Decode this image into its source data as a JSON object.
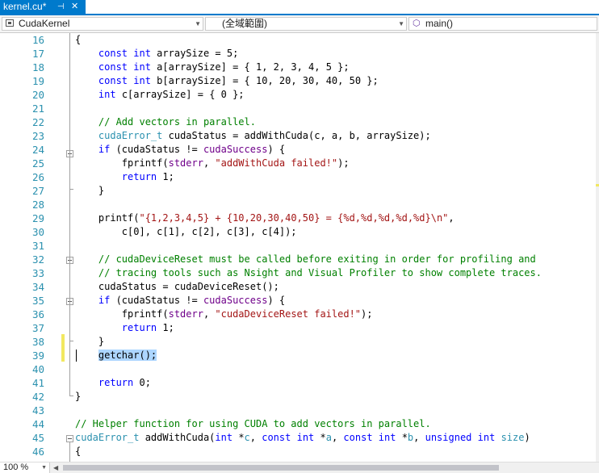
{
  "tab": {
    "title": "kernel.cu*",
    "pin_icon": "pin-icon",
    "close_icon": "close-icon"
  },
  "navbar": {
    "project": "CudaKernel",
    "scope": "(全域範圍)",
    "member": "main()"
  },
  "editor": {
    "lines": [
      {
        "n": "16",
        "s": [
          {
            "t": "{"
          }
        ]
      },
      {
        "n": "17",
        "s": [
          {
            "t": "    "
          },
          {
            "t": "const",
            "c": "kw"
          },
          {
            "t": " "
          },
          {
            "t": "int",
            "c": "kw"
          },
          {
            "t": " arraySize = 5;"
          }
        ]
      },
      {
        "n": "18",
        "s": [
          {
            "t": "    "
          },
          {
            "t": "const",
            "c": "kw"
          },
          {
            "t": " "
          },
          {
            "t": "int",
            "c": "kw"
          },
          {
            "t": " a[arraySize] = { 1, 2, 3, 4, 5 };"
          }
        ]
      },
      {
        "n": "19",
        "s": [
          {
            "t": "    "
          },
          {
            "t": "const",
            "c": "kw"
          },
          {
            "t": " "
          },
          {
            "t": "int",
            "c": "kw"
          },
          {
            "t": " b[arraySize] = { 10, 20, 30, 40, 50 };"
          }
        ]
      },
      {
        "n": "20",
        "s": [
          {
            "t": "    "
          },
          {
            "t": "int",
            "c": "kw"
          },
          {
            "t": " c[arraySize] = { 0 };"
          }
        ]
      },
      {
        "n": "21",
        "s": []
      },
      {
        "n": "22",
        "s": [
          {
            "t": "    "
          },
          {
            "t": "// Add vectors in parallel.",
            "c": "cm"
          }
        ]
      },
      {
        "n": "23",
        "s": [
          {
            "t": "    "
          },
          {
            "t": "cudaError_t",
            "c": "ty"
          },
          {
            "t": " cudaStatus = addWithCuda(c, a, b, arraySize);"
          }
        ]
      },
      {
        "n": "24",
        "s": [
          {
            "t": "    "
          },
          {
            "t": "if",
            "c": "kw"
          },
          {
            "t": " (cudaStatus != "
          },
          {
            "t": "cudaSuccess",
            "c": "mac"
          },
          {
            "t": ") {"
          }
        ]
      },
      {
        "n": "25",
        "s": [
          {
            "t": "        fprintf("
          },
          {
            "t": "stderr",
            "c": "mac"
          },
          {
            "t": ", "
          },
          {
            "t": "\"addWithCuda failed!\"",
            "c": "str"
          },
          {
            "t": ");"
          }
        ]
      },
      {
        "n": "26",
        "s": [
          {
            "t": "        "
          },
          {
            "t": "return",
            "c": "kw"
          },
          {
            "t": " 1;"
          }
        ]
      },
      {
        "n": "27",
        "s": [
          {
            "t": "    }"
          }
        ]
      },
      {
        "n": "28",
        "s": []
      },
      {
        "n": "29",
        "s": [
          {
            "t": "    printf("
          },
          {
            "t": "\"{1,2,3,4,5} + {10,20,30,40,50} = {%d,%d,%d,%d,%d}\\n\"",
            "c": "str"
          },
          {
            "t": ","
          }
        ]
      },
      {
        "n": "30",
        "s": [
          {
            "t": "        c[0], c[1], c[2], c[3], c[4]);"
          }
        ]
      },
      {
        "n": "31",
        "s": []
      },
      {
        "n": "32",
        "s": [
          {
            "t": "    "
          },
          {
            "t": "// cudaDeviceReset must be called before exiting in order for profiling and",
            "c": "cm"
          }
        ]
      },
      {
        "n": "33",
        "s": [
          {
            "t": "    "
          },
          {
            "t": "// tracing tools such as Nsight and Visual Profiler to show complete traces.",
            "c": "cm"
          }
        ]
      },
      {
        "n": "34",
        "s": [
          {
            "t": "    cudaStatus = cudaDeviceReset();"
          }
        ]
      },
      {
        "n": "35",
        "s": [
          {
            "t": "    "
          },
          {
            "t": "if",
            "c": "kw"
          },
          {
            "t": " (cudaStatus != "
          },
          {
            "t": "cudaSuccess",
            "c": "mac"
          },
          {
            "t": ") {"
          }
        ]
      },
      {
        "n": "36",
        "s": [
          {
            "t": "        fprintf("
          },
          {
            "t": "stderr",
            "c": "mac"
          },
          {
            "t": ", "
          },
          {
            "t": "\"cudaDeviceReset failed!\"",
            "c": "str"
          },
          {
            "t": ");"
          }
        ]
      },
      {
        "n": "37",
        "s": [
          {
            "t": "        "
          },
          {
            "t": "return",
            "c": "kw"
          },
          {
            "t": " 1;"
          }
        ]
      },
      {
        "n": "38",
        "s": [
          {
            "t": "    }"
          }
        ]
      },
      {
        "n": "39",
        "s": [
          {
            "t": "    getchar();",
            "c": "sel"
          }
        ]
      },
      {
        "n": "40",
        "s": []
      },
      {
        "n": "41",
        "s": [
          {
            "t": "    "
          },
          {
            "t": "return",
            "c": "kw"
          },
          {
            "t": " 0;"
          }
        ]
      },
      {
        "n": "42",
        "s": [
          {
            "t": "}"
          }
        ]
      },
      {
        "n": "43",
        "s": []
      },
      {
        "n": "44",
        "s": [
          {
            "t": "// Helper function for using CUDA to add vectors in parallel.",
            "c": "cm"
          }
        ]
      },
      {
        "n": "45",
        "s": [
          {
            "t": "cudaError_t",
            "c": "ty"
          },
          {
            "t": " addWithCuda("
          },
          {
            "t": "int",
            "c": "kw"
          },
          {
            "t": " *"
          },
          {
            "t": "c",
            "c": "ty"
          },
          {
            "t": ", "
          },
          {
            "t": "const",
            "c": "kw"
          },
          {
            "t": " "
          },
          {
            "t": "int",
            "c": "kw"
          },
          {
            "t": " *"
          },
          {
            "t": "a",
            "c": "ty"
          },
          {
            "t": ", "
          },
          {
            "t": "const",
            "c": "kw"
          },
          {
            "t": " "
          },
          {
            "t": "int",
            "c": "kw"
          },
          {
            "t": " *"
          },
          {
            "t": "b",
            "c": "ty"
          },
          {
            "t": ", "
          },
          {
            "t": "unsigned",
            "c": "kw"
          },
          {
            "t": " "
          },
          {
            "t": "int",
            "c": "kw"
          },
          {
            "t": " "
          },
          {
            "t": "size",
            "c": "ty"
          },
          {
            "t": ")"
          }
        ]
      },
      {
        "n": "46",
        "s": [
          {
            "t": "{"
          }
        ]
      }
    ]
  },
  "status": {
    "zoom": "100 %"
  },
  "colors": {
    "accent": "#007acc",
    "keyword": "#0000ff",
    "type": "#2b91af",
    "string": "#a31515",
    "comment": "#008000",
    "selection": "#add6ff",
    "changed": "#f2e860"
  }
}
